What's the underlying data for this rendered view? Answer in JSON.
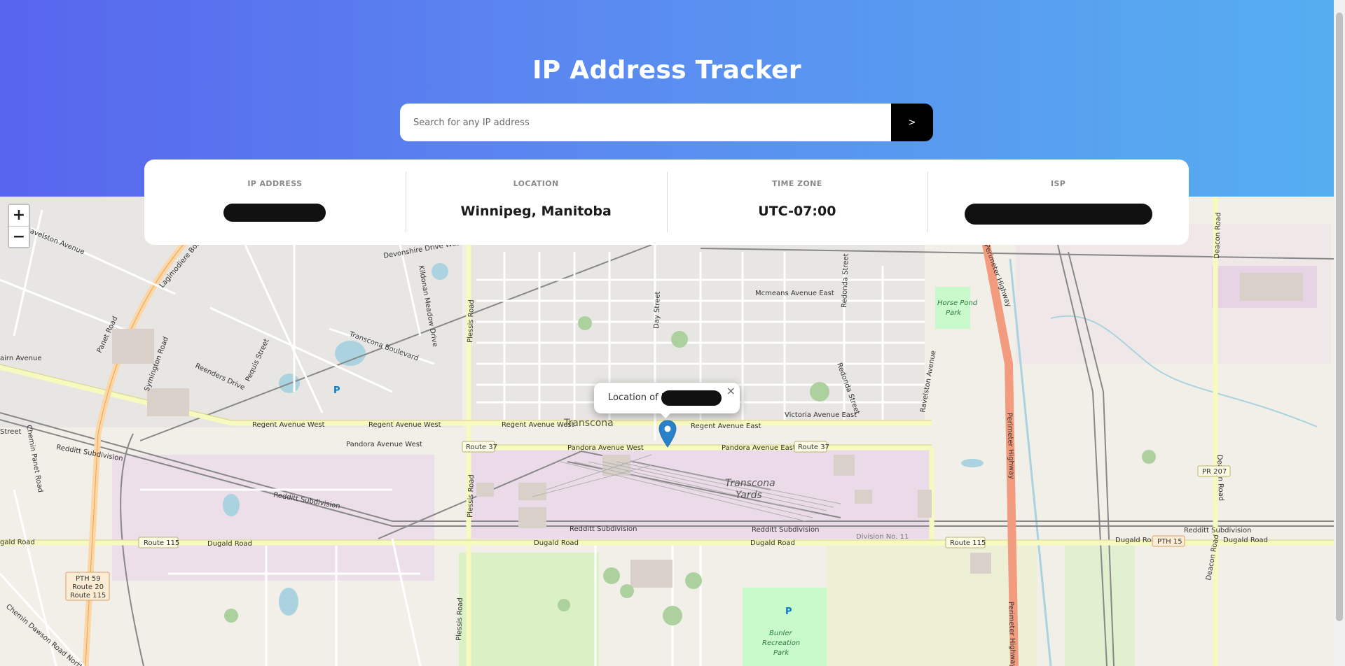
{
  "header": {
    "title": "IP Address Tracker",
    "search_placeholder": "Search for any IP address",
    "search_button": ">"
  },
  "info": {
    "ip_label": "IP ADDRESS",
    "location_label": "LOCATION",
    "location_value": "Winnipeg, Manitoba",
    "timezone_label": "TIME ZONE",
    "timezone_value": "UTC-07:00",
    "isp_label": "ISP"
  },
  "map": {
    "zoom_in": "+",
    "zoom_out": "−",
    "popup_text": "Location of IP",
    "popup_close": "×",
    "labels": {
      "transcona": "Transcona",
      "transcona_yards_1": "Transcona",
      "transcona_yards_2": "Yards",
      "regent_w1": "Regent Avenue West",
      "regent_w2": "Regent Avenue West",
      "regent_w3": "Regent Avenue West",
      "regent_e": "Regent Avenue East",
      "pandora_w1": "Pandora Avenue West",
      "pandora_w2": "Pandora Avenue West",
      "pandora_e": "Pandora Avenue East",
      "dugald1": "Dugald Road",
      "dugald2": "Dugald Road",
      "dugald3": "Dugald Road",
      "dugald4": "Dugald Road",
      "dugald5": "Dugald Road",
      "route37a": "Route 37",
      "route37b": "Route 37",
      "route115a": "Route 115",
      "route115b": "Route 115",
      "pth15": "PTH 15",
      "pr207": "PR 207",
      "pth59_1": "PTH 59",
      "pth59_2": "Route 20",
      "pth59_3": "Route 115",
      "redditt1": "Redditt Subdivision",
      "redditt2": "Redditt Subdivision",
      "redditt3": "Redditt Subdivision",
      "redditt4": "Redditt Subdivision",
      "redditt5": "Redditt Subdivision",
      "division11": "Division No. 11",
      "victoria": "Victoria Avenue East",
      "mcmeans": "Mcmeans Avenue East",
      "horsepond1": "Horse Pond",
      "horsepond2": "Park",
      "bunker1": "Bunler",
      "bunker2": "Recreation",
      "bunker3": "Park",
      "transcona_blvd": "Transcona Boulevard",
      "perimeter": "Perimeter Highway",
      "deacon": "Deacon Road",
      "plessis": "Plessis Road",
      "day": "Day Street",
      "redonda": "Redonda Street",
      "ravelston": "Ravelston Avenue",
      "lagimodiere": "Lagimodiere Boulevard",
      "panet": "Panet Road",
      "reenders": "Reenders Drive",
      "pequis": "Pequis Street",
      "devonshire": "Devonshire Drive West",
      "kildonan": "Kildonan Meadow Drive",
      "chemin_panet": "Chemin Panet Road",
      "chemin_dawson": "Chemin Dawson Road North",
      "fermor": "airn Avenue",
      "street_left": "Street",
      "gald": "gald Road",
      "symington": "Symington Road",
      "parking": "P"
    }
  },
  "colors": {
    "gradient_start": "#5865ee",
    "gradient_end": "#56aef0",
    "button_bg": "#000000",
    "marker": "#2a81cb"
  }
}
